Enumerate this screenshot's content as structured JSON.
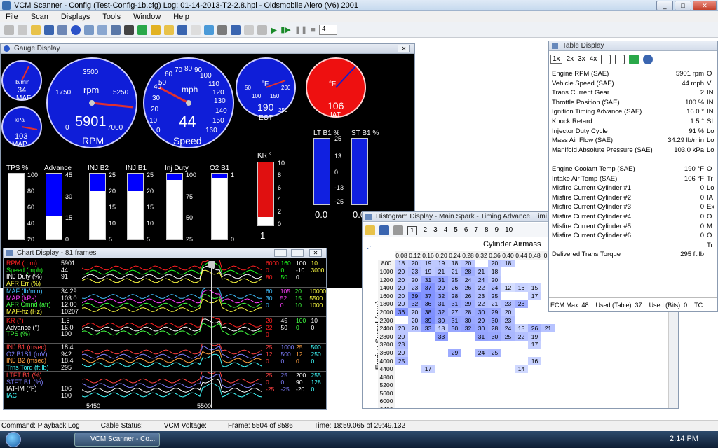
{
  "window": {
    "title": "VCM Scanner - Config (Test-Config-1b.cfg)  Log: 01-14-2013-T2-2.8.hpl - Oldsmobile Alero (V6) 2001"
  },
  "menu": [
    "File",
    "Scan",
    "Displays",
    "Tools",
    "Window",
    "Help"
  ],
  "toolbar": {
    "spin_value": "4"
  },
  "gauge": {
    "title": "Gauge Display",
    "maf": {
      "value": "34",
      "label": "MAF",
      "unit": "lb/min"
    },
    "map": {
      "value": "103",
      "label": "MAP",
      "unit": "kPa"
    },
    "rpm": {
      "value": "5901",
      "label": "RPM",
      "unit": "rpm",
      "ticks": [
        "0",
        "1750",
        "3500",
        "5250",
        "7000"
      ]
    },
    "speed": {
      "value": "44",
      "label": "Speed",
      "unit": "mph",
      "ticks": [
        "0",
        "10",
        "20",
        "30",
        "40",
        "50",
        "60",
        "70",
        "80",
        "90",
        "100",
        "110",
        "120",
        "130",
        "140",
        "150",
        "160"
      ]
    },
    "ect": {
      "value": "190",
      "label": "ECT",
      "unit": "°F",
      "ticks": [
        "50",
        "100",
        "150",
        "200",
        "250"
      ]
    },
    "iat": {
      "value": "106",
      "label": "IAT",
      "unit": "°F"
    },
    "bars": [
      {
        "label": "TPS %",
        "ticks": [
          "100",
          "80",
          "60",
          "40",
          "20"
        ],
        "value": "100",
        "fill": 1.0,
        "color": "#ffffff"
      },
      {
        "label": "Advance",
        "ticks": [
          "45",
          "30",
          "15",
          "0"
        ],
        "value": "16",
        "fill": 0.36,
        "color": "#0000ff"
      },
      {
        "label": "INJ B2",
        "ticks": [
          "25",
          "20",
          "15",
          "10",
          "5"
        ],
        "value": "18.4",
        "fill": 0.74,
        "color": "#0000ff"
      },
      {
        "label": "INJ B1",
        "ticks": [
          "25",
          "20",
          "15",
          "10",
          "5"
        ],
        "value": "18.4",
        "fill": 0.74,
        "color": "#0000ff"
      },
      {
        "label": "Inj Duty",
        "ticks": [
          "100",
          "75",
          "50",
          "25"
        ],
        "value": "91",
        "fill": 0.91,
        "color": "#0000ff"
      },
      {
        "label": "O2 B1",
        "ticks": [
          "1",
          "0"
        ],
        "value": "0.94",
        "fill": 0.94,
        "color": "#0000ff"
      }
    ],
    "kr": {
      "label": "KR °",
      "ticks": [
        "10",
        "8",
        "6",
        "4",
        "2",
        "0"
      ],
      "value": "1",
      "fill": 0.15
    },
    "ltft": {
      "label": "LT B1 %",
      "ticks": [
        "25",
        "13",
        "0",
        "-13",
        "-25"
      ],
      "value": "0.0"
    },
    "stft": {
      "label": "ST B1 %",
      "value": "0.0"
    }
  },
  "chart": {
    "title": "Chart Display - 81 frames",
    "groups": [
      {
        "rows": [
          {
            "n": "RPM (rpm)",
            "v": "5901",
            "c": "#ff2020"
          },
          {
            "n": "Speed (mph)",
            "v": "44",
            "c": "#20ff20"
          },
          {
            "n": "INJ Duty (%)",
            "v": "91",
            "c": "#ffffff"
          },
          {
            "n": "AFR Err (%)",
            "v": "",
            "c": "#ffff40"
          }
        ],
        "scale": [
          "6000",
          "160",
          "100",
          "10",
          "0",
          "0",
          "-10",
          "3000",
          "80",
          "50",
          "0"
        ]
      },
      {
        "rows": [
          {
            "n": "MAF (lb/min)",
            "v": "34.29",
            "c": "#40c0ff"
          },
          {
            "n": "MAP (kPa)",
            "v": "103.0",
            "c": "#ff40ff"
          },
          {
            "n": "AFR Cmnd (afr)",
            "v": "12.00",
            "c": "#40ff40"
          },
          {
            "n": "MAF-hz (Hz)",
            "v": "10207",
            "c": "#ffff40"
          }
        ],
        "scale": [
          "60",
          "105",
          "20",
          "10000",
          "30",
          "52",
          "15",
          "5500",
          "0",
          "0",
          "10",
          "1000"
        ]
      },
      {
        "rows": [
          {
            "n": "KR (°)",
            "v": "1.5",
            "c": "#ff2020"
          },
          {
            "n": "Advance (°)",
            "v": "16.0",
            "c": "#ffffff"
          },
          {
            "n": "TPS (%)",
            "v": "100",
            "c": "#40ff40"
          }
        ],
        "scale": [
          "20",
          "45",
          "100",
          "10",
          "22",
          "50",
          "0",
          "0",
          "0"
        ]
      },
      {
        "rows": [
          {
            "n": "INJ B1 (msec)",
            "v": "18.4",
            "c": "#ff4040"
          },
          {
            "n": "O2 B1S1 (mV)",
            "v": "942",
            "c": "#8080ff"
          },
          {
            "n": "INJ B2 (msec)",
            "v": "18.4",
            "c": "#ffa040"
          },
          {
            "n": "Trns Torq (ft.lb)",
            "v": "295",
            "c": "#40ffff"
          }
        ],
        "scale": [
          "25",
          "1000",
          "25",
          "500",
          "12",
          "500",
          "12",
          "250",
          "0",
          "0",
          "0",
          "0"
        ]
      },
      {
        "rows": [
          {
            "n": "LTFT B1 (%)",
            "v": "",
            "c": "#ff4040"
          },
          {
            "n": "STFT B1 (%)",
            "v": "",
            "c": "#8080ff"
          },
          {
            "n": "IAT-IM (°F)",
            "v": "106",
            "c": "#ffffff"
          },
          {
            "n": "IAC",
            "v": "100",
            "c": "#40ffff"
          }
        ],
        "scale": [
          "25",
          "25",
          "200",
          "255",
          "0",
          "0",
          "90",
          "128",
          "-25",
          "-25",
          "-20",
          "0"
        ]
      }
    ],
    "axis": [
      "5450",
      "5500"
    ]
  },
  "hist": {
    "title": "Histogram Display - Main Spark - Timing Advance, Timi",
    "tabs": [
      "1",
      "2",
      "3",
      "4",
      "5",
      "6",
      "7",
      "8",
      "9",
      "10"
    ],
    "col_label": "Cylinder Airmass",
    "row_label": "Engine Speed (rpm)",
    "cols": [
      "0.08",
      "0.12",
      "0.16",
      "0.20",
      "0.24",
      "0.28",
      "0.32",
      "0.36",
      "0.40",
      "0.44",
      "0.48",
      "0.5"
    ],
    "rows": [
      [
        "800",
        "18",
        "20",
        "19",
        "19",
        "18",
        "20",
        "",
        "20",
        "18",
        "",
        "",
        ""
      ],
      [
        "1000",
        "20",
        "23",
        "19",
        "21",
        "21",
        "28",
        "21",
        "18",
        "",
        "",
        "",
        ""
      ],
      [
        "1200",
        "20",
        "20",
        "31",
        "31",
        "25",
        "24",
        "24",
        "20",
        "",
        "",
        "",
        ""
      ],
      [
        "1400",
        "20",
        "23",
        "37",
        "29",
        "26",
        "26",
        "22",
        "24",
        "12",
        "16",
        "15",
        ""
      ],
      [
        "1600",
        "20",
        "39",
        "37",
        "32",
        "28",
        "26",
        "23",
        "25",
        "",
        "",
        "17",
        ""
      ],
      [
        "1800",
        "20",
        "32",
        "36",
        "31",
        "31",
        "29",
        "22",
        "21",
        "23",
        "28",
        "",
        ""
      ],
      [
        "2000",
        "36",
        "20",
        "38",
        "32",
        "27",
        "28",
        "30",
        "29",
        "20",
        "",
        "",
        ""
      ],
      [
        "2200",
        "",
        "20",
        "39",
        "30",
        "31",
        "30",
        "29",
        "30",
        "23",
        "",
        "",
        ""
      ],
      [
        "2400",
        "20",
        "20",
        "33",
        "18",
        "30",
        "32",
        "30",
        "28",
        "24",
        "15",
        "26",
        "21"
      ],
      [
        "2800",
        "20",
        "",
        "",
        "33",
        "",
        "",
        "31",
        "30",
        "25",
        "22",
        "19",
        ""
      ],
      [
        "3200",
        "23",
        "",
        "",
        "",
        "",
        "",
        "",
        "",
        "",
        "",
        "17",
        ""
      ],
      [
        "3600",
        "20",
        "",
        "",
        "",
        "29",
        "",
        "24",
        "25",
        "",
        "",
        "",
        ""
      ],
      [
        "4000",
        "25",
        "",
        "",
        "",
        "",
        "",
        "",
        "",
        "",
        "",
        "16",
        ""
      ],
      [
        "4400",
        "",
        "",
        "17",
        "",
        "",
        "",
        "",
        "",
        "",
        "14",
        "",
        ""
      ],
      [
        "4800",
        "",
        "",
        "",
        "",
        "",
        "",
        "",
        "",
        "",
        "",
        "",
        ""
      ],
      [
        "5200",
        "",
        "",
        "",
        "",
        "",
        "",
        "",
        "",
        "",
        "",
        "",
        ""
      ],
      [
        "5600",
        "",
        "",
        "",
        "",
        "",
        "",
        "",
        "",
        "",
        "",
        "",
        ""
      ],
      [
        "6000",
        "",
        "",
        "",
        "",
        "",
        "",
        "",
        "",
        "",
        "",
        "",
        ""
      ],
      [
        "6400",
        "",
        "",
        "",
        "",
        "",
        "",
        "",
        "",
        "",
        "",
        "",
        ""
      ]
    ],
    "extra": [
      [
        "",
        "25"
      ],
      [
        "17",
        ""
      ],
      [
        "17",
        "14"
      ],
      [
        "",
        ""
      ],
      [
        "17",
        "18"
      ],
      [
        "16",
        "17"
      ],
      [
        "16",
        "14"
      ],
      [
        "",
        "16"
      ],
      [
        "",
        "16"
      ],
      [
        "",
        "16"
      ],
      [
        "17",
        "16"
      ]
    ]
  },
  "table": {
    "title": "Table Display",
    "zoom": [
      "1x",
      "2x",
      "3x",
      "4x"
    ],
    "rows": [
      {
        "n": "Engine RPM (SAE)",
        "v": "5901 rpm",
        "e": "O"
      },
      {
        "n": "Vehicle Speed (SAE)",
        "v": "44 mph",
        "e": "V"
      },
      {
        "n": "Trans Current Gear",
        "v": "2",
        "e": "IN"
      },
      {
        "n": "Throttle Position (SAE)",
        "v": "100 %",
        "e": "IN"
      },
      {
        "n": "Ignition Timing Advance (SAE)",
        "v": "16.0 °",
        "e": "IN"
      },
      {
        "n": "Knock Retard",
        "v": "1.5 °",
        "e": "SI"
      },
      {
        "n": "Injector Duty Cycle",
        "v": "91 %",
        "e": "Lo"
      },
      {
        "n": "Mass Air Flow (SAE)",
        "v": "34.29 lb/min",
        "e": "Lo"
      },
      {
        "n": "Manifold Absolute Pressure (SAE)",
        "v": "103.0 kPa",
        "e": "Lo"
      },
      {
        "n": "",
        "v": "",
        "e": ""
      },
      {
        "n": "Engine Coolant Temp (SAE)",
        "v": "190 °F",
        "e": "O"
      },
      {
        "n": "Intake Air Temp (SAE)",
        "v": "106 °F",
        "e": "Tr"
      },
      {
        "n": "Misfire Current Cylinder #1",
        "v": "0",
        "e": "Lo"
      },
      {
        "n": "Misfire Current Cylinder #2",
        "v": "0",
        "e": "IA"
      },
      {
        "n": "Misfire Current Cylinder #3",
        "v": "0",
        "e": "Ex"
      },
      {
        "n": "Misfire Current Cylinder #4",
        "v": "0",
        "e": "O"
      },
      {
        "n": "Misfire Current Cylinder #5",
        "v": "0",
        "e": "M"
      },
      {
        "n": "Misfire Current Cylinder #6",
        "v": "0",
        "e": "O"
      },
      {
        "n": "",
        "v": "",
        "e": "Tr"
      },
      {
        "n": "Delivered Trans Torque",
        "v": "295 ft.lb",
        "e": ""
      }
    ],
    "footer": [
      "ECM Max: 48",
      "Used (Table): 37",
      "Used (Bits): 0",
      "TC"
    ]
  },
  "status": {
    "command": "Command:  Playback Log",
    "cable": "Cable Status:",
    "voltage": "VCM Voltage:",
    "frame": "Frame:  5504 of 8586",
    "time": "Time:  18:59.065 of 29:49.132"
  },
  "taskbar": {
    "task": "VCM Scanner - Co...",
    "clock": "2:14 PM"
  }
}
